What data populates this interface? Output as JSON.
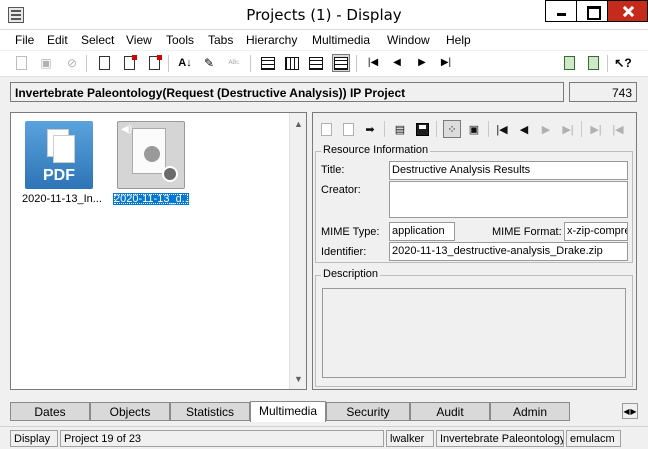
{
  "window": {
    "title": "Projects (1) - Display"
  },
  "menu": [
    "File",
    "Edit",
    "Select",
    "View",
    "Tools",
    "Tabs",
    "Hierarchy",
    "Multimedia",
    "Window",
    "Help"
  ],
  "project": {
    "name": "Invertebrate Paleontology(Request (Destructive Analysis)) IP Project",
    "count": "743"
  },
  "files": [
    {
      "name": "2020-11-13_In...",
      "type": "PDF",
      "icon": "pdf-file-icon",
      "selected": false
    },
    {
      "name": "2020-11-13_d...",
      "icon": "media-file-icon",
      "selected": true
    }
  ],
  "resource": {
    "legend": "Resource Information",
    "title_label": "Title:",
    "title_value": "Destructive Analysis Results",
    "creator_label": "Creator:",
    "creator_value": "",
    "mime_type_label": "MIME Type:",
    "mime_type_value": "application",
    "mime_format_label": "MIME Format:",
    "mime_format_value": "x-zip-compre",
    "identifier_label": "Identifier:",
    "identifier_value": "2020-11-13_destructive-analysis_Drake.zip"
  },
  "description": {
    "legend": "Description",
    "value": ""
  },
  "tabs": [
    {
      "label": "Dates",
      "active": false
    },
    {
      "label": "Objects",
      "active": false
    },
    {
      "label": "Statistics",
      "active": false
    },
    {
      "label": "Multimedia",
      "active": true
    },
    {
      "label": "Security",
      "active": false
    },
    {
      "label": "Audit",
      "active": false
    },
    {
      "label": "Admin",
      "active": false
    }
  ],
  "status": {
    "mode": "Display",
    "record": "Project 19 of 23",
    "user": "lwalker",
    "department": "Invertebrate Paleontology",
    "database": "emulacm"
  }
}
